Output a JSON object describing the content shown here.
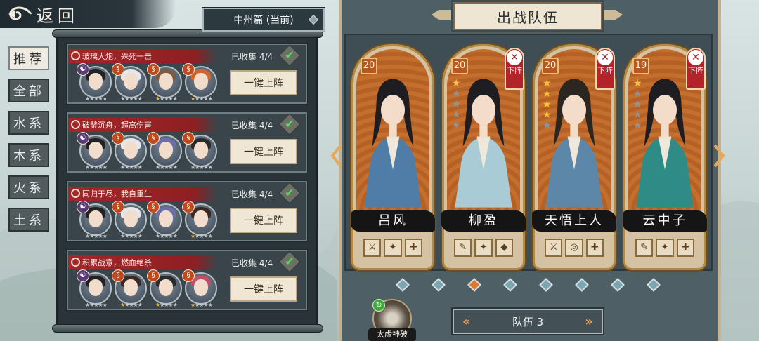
{
  "back": {
    "label": "返回"
  },
  "chapter": {
    "label": "中州篇 (当前)"
  },
  "tabs": [
    {
      "label": "推荐",
      "active": true
    },
    {
      "label": "全部",
      "active": false
    },
    {
      "label": "水系",
      "active": false
    },
    {
      "label": "木系",
      "active": false
    },
    {
      "label": "火系",
      "active": false
    },
    {
      "label": "土系",
      "active": false
    }
  ],
  "teams": [
    {
      "title": "玻璃大炮，殊死一击",
      "collected": "已收集 4/4",
      "deploy": "一键上阵",
      "heroes": [
        {
          "element": "☯",
          "elem_color": "#5a3b7a",
          "hair": "#222",
          "stars_on": 0
        },
        {
          "element": "§",
          "elem_color": "#c04a1e",
          "hair": "#e6e6ea",
          "stars_on": 0
        },
        {
          "element": "§",
          "elem_color": "#c04a1e",
          "hair": "#7b5a3d",
          "stars_on": 1
        },
        {
          "element": "§",
          "elem_color": "#c04a1e",
          "hair": "#d4652a",
          "stars_on": 1
        }
      ]
    },
    {
      "title": "破釜沉舟，超高伤害",
      "collected": "已收集 4/4",
      "deploy": "一键上阵",
      "heroes": [
        {
          "element": "☯",
          "elem_color": "#5a3b7a",
          "hair": "#222",
          "stars_on": 0
        },
        {
          "element": "§",
          "elem_color": "#c04a1e",
          "hair": "#e6e6ea",
          "stars_on": 0
        },
        {
          "element": "§",
          "elem_color": "#c04a1e",
          "hair": "#6a6fa8",
          "stars_on": 0
        },
        {
          "element": "§",
          "elem_color": "#c04a1e",
          "hair": "#2b2b2b",
          "stars_on": 0
        }
      ]
    },
    {
      "title": "同归于尽，我自重生",
      "collected": "已收集 4/4",
      "deploy": "一键上阵",
      "heroes": [
        {
          "element": "☯",
          "elem_color": "#5a3b7a",
          "hair": "#222",
          "stars_on": 0
        },
        {
          "element": "§",
          "elem_color": "#c04a1e",
          "hair": "#e6e6ea",
          "stars_on": 0
        },
        {
          "element": "§",
          "elem_color": "#c04a1e",
          "hair": "#6a6fa8",
          "stars_on": 0
        },
        {
          "element": "§",
          "elem_color": "#c04a1e",
          "hair": "#3a2a25",
          "stars_on": 1
        }
      ]
    },
    {
      "title": "积累战意，燃血绝杀",
      "collected": "已收集 4/4",
      "deploy": "一键上阵",
      "heroes": [
        {
          "element": "☯",
          "elem_color": "#5a3b7a",
          "hair": "#222",
          "stars_on": 0
        },
        {
          "element": "§",
          "elem_color": "#c04a1e",
          "hair": "#3a2a25",
          "stars_on": 1
        },
        {
          "element": "§",
          "elem_color": "#c04a1e",
          "hair": "#2b2b2b",
          "stars_on": 1
        },
        {
          "element": "§",
          "elem_color": "#c04a1e",
          "hair": "#c0506a",
          "stars_on": 1
        }
      ]
    }
  ],
  "battle": {
    "title": "出战队伍",
    "heroes": [
      {
        "name": "吕风",
        "level": "20",
        "stars_on": 0,
        "show_stars": false,
        "removable": false,
        "remove_label": "下阵",
        "hair": "#1d1d22",
        "robe": "#4f7da8",
        "equip": [
          "⚔",
          "✦",
          "✚"
        ]
      },
      {
        "name": "柳盈",
        "level": "20",
        "stars_on": 1,
        "show_stars": true,
        "removable": true,
        "remove_label": "下阵",
        "hair": "#1d1d22",
        "robe": "#a9cbd6",
        "equip": [
          "✎",
          "✦",
          "◆"
        ]
      },
      {
        "name": "天悟上人",
        "level": "20",
        "stars_on": 4,
        "show_stars": true,
        "removable": true,
        "remove_label": "下阵",
        "hair": "#2c2620",
        "robe": "#5d87a8",
        "equip": [
          "⚔",
          "◎",
          "✚"
        ]
      },
      {
        "name": "云中子",
        "level": "19",
        "stars_on": 1,
        "show_stars": true,
        "removable": true,
        "remove_label": "下阵",
        "hair": "#1d1d22",
        "robe": "#2f8b86",
        "equip": [
          "✎",
          "✦",
          "✚"
        ]
      }
    ],
    "page_count": 8,
    "active_page": 2
  },
  "team_nav": {
    "label": "队伍 3"
  },
  "skill": {
    "label": "太虚神破"
  }
}
